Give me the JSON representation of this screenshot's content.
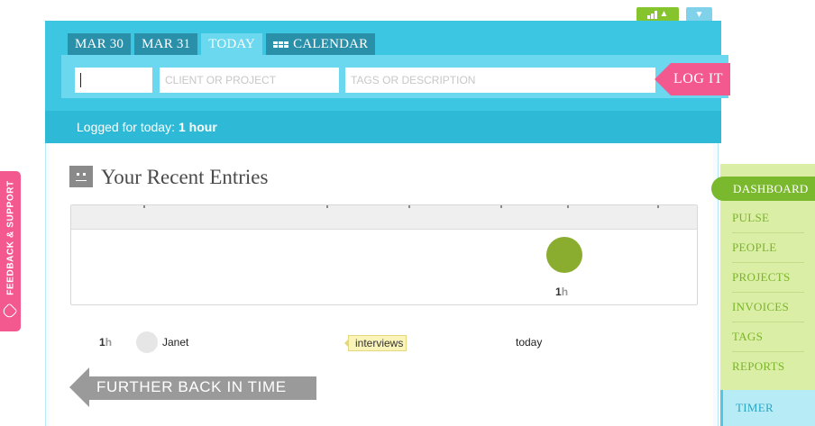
{
  "top_controls": {
    "stats_icon": "bar-chart-icon",
    "collapse_icon": "chevron-down-icon"
  },
  "header": {
    "tabs": [
      {
        "label": "MAR 30",
        "active": false
      },
      {
        "label": "MAR 31",
        "active": false
      },
      {
        "label": "TODAY",
        "active": true
      },
      {
        "label": "CALENDAR",
        "icon": "calendar-icon",
        "active": false
      }
    ],
    "entry_form": {
      "time_value": "",
      "client_placeholder": "CLIENT OR PROJECT",
      "tags_placeholder": "TAGS OR DESCRIPTION",
      "log_button": "LOG IT"
    },
    "logged_label": "Logged for today:",
    "logged_value": "1 hour"
  },
  "recent": {
    "title": "Your Recent Entries",
    "bubble_value": "1",
    "bubble_unit": "h",
    "entries": [
      {
        "duration": "1",
        "unit": "h",
        "user": "Janet",
        "tag": "interviews",
        "date": "today"
      }
    ],
    "further_button": "FURTHER BACK IN TIME"
  },
  "feedback": {
    "label": "FEEDBACK & SUPPORT"
  },
  "nav": {
    "items": [
      "DASHBOARD",
      "PULSE",
      "PEOPLE",
      "PROJECTS",
      "INVOICES",
      "TAGS",
      "REPORTS"
    ],
    "active": "DASHBOARD",
    "timer": "TIMER"
  },
  "colors": {
    "header": "#3cc6e1",
    "accent_pink": "#f3588f",
    "nav_green": "#7ab92d",
    "bubble_green": "#8aac2f"
  }
}
